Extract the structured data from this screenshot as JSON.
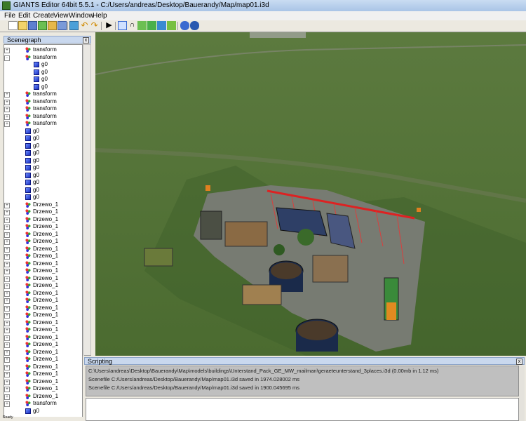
{
  "window": {
    "title": "GIANTS Editor 64bit 5.5.1 - C:/Users/andreas/Desktop/Bauerandy/Map/map01.i3d"
  },
  "menu": [
    "File",
    "Edit",
    "Create",
    "View",
    "Window",
    "Help"
  ],
  "toolbar_icons": [
    "new-icon",
    "open-icon",
    "save-icon",
    "reload-icon",
    "import-icon",
    "export-icon",
    "refresh-icon",
    "undo-icon",
    "redo-icon",
    "play-icon",
    "select-icon",
    "move-icon",
    "terrain-paint-icon",
    "foliage-icon",
    "texture-paint-icon",
    "placement-icon",
    "settings-icon",
    "info-icon"
  ],
  "scenegraph": {
    "title": "Scenegraph",
    "close": "x",
    "nodes": [
      {
        "label": "transform",
        "type": "transform",
        "depth": 1,
        "expander": "+"
      },
      {
        "label": "transform",
        "type": "transform",
        "depth": 1,
        "expander": "-"
      },
      {
        "label": "g0",
        "type": "shape",
        "depth": 2,
        "expander": ""
      },
      {
        "label": "g0",
        "type": "shape",
        "depth": 2,
        "expander": ""
      },
      {
        "label": "g0",
        "type": "shape",
        "depth": 2,
        "expander": ""
      },
      {
        "label": "g0",
        "type": "shape",
        "depth": 2,
        "expander": ""
      },
      {
        "label": "transform",
        "type": "transform",
        "depth": 1,
        "expander": "+"
      },
      {
        "label": "transform",
        "type": "transform",
        "depth": 1,
        "expander": "+"
      },
      {
        "label": "transform",
        "type": "transform",
        "depth": 1,
        "expander": "+"
      },
      {
        "label": "transform",
        "type": "transform",
        "depth": 1,
        "expander": "+"
      },
      {
        "label": "transform",
        "type": "transform",
        "depth": 1,
        "expander": "+"
      },
      {
        "label": "g0",
        "type": "shape",
        "depth": 1,
        "expander": ""
      },
      {
        "label": "g0",
        "type": "shape",
        "depth": 1,
        "expander": ""
      },
      {
        "label": "g0",
        "type": "shape",
        "depth": 1,
        "expander": ""
      },
      {
        "label": "g0",
        "type": "shape",
        "depth": 1,
        "expander": ""
      },
      {
        "label": "g0",
        "type": "shape",
        "depth": 1,
        "expander": ""
      },
      {
        "label": "g0",
        "type": "shape",
        "depth": 1,
        "expander": ""
      },
      {
        "label": "g0",
        "type": "shape",
        "depth": 1,
        "expander": ""
      },
      {
        "label": "g0",
        "type": "shape",
        "depth": 1,
        "expander": ""
      },
      {
        "label": "g0",
        "type": "shape",
        "depth": 1,
        "expander": ""
      },
      {
        "label": "g0",
        "type": "shape",
        "depth": 1,
        "expander": ""
      },
      {
        "label": "Drzewo_1",
        "type": "transform",
        "depth": 1,
        "expander": "+"
      },
      {
        "label": "Drzewo_1",
        "type": "transform",
        "depth": 1,
        "expander": "+"
      },
      {
        "label": "Drzewo_1",
        "type": "transform",
        "depth": 1,
        "expander": "+"
      },
      {
        "label": "Drzewo_1",
        "type": "transform",
        "depth": 1,
        "expander": "+"
      },
      {
        "label": "Drzewo_1",
        "type": "transform",
        "depth": 1,
        "expander": "+"
      },
      {
        "label": "Drzewo_1",
        "type": "transform",
        "depth": 1,
        "expander": "+"
      },
      {
        "label": "Drzewo_1",
        "type": "transform",
        "depth": 1,
        "expander": "+"
      },
      {
        "label": "Drzewo_1",
        "type": "transform",
        "depth": 1,
        "expander": "+"
      },
      {
        "label": "Drzewo_1",
        "type": "transform",
        "depth": 1,
        "expander": "+"
      },
      {
        "label": "Drzewo_1",
        "type": "transform",
        "depth": 1,
        "expander": "+"
      },
      {
        "label": "Drzewo_1",
        "type": "transform",
        "depth": 1,
        "expander": "+"
      },
      {
        "label": "Drzewo_1",
        "type": "transform",
        "depth": 1,
        "expander": "+"
      },
      {
        "label": "Drzewo_1",
        "type": "transform",
        "depth": 1,
        "expander": "+"
      },
      {
        "label": "Drzewo_1",
        "type": "transform",
        "depth": 1,
        "expander": "+"
      },
      {
        "label": "Drzewo_1",
        "type": "transform",
        "depth": 1,
        "expander": "+"
      },
      {
        "label": "Drzewo_1",
        "type": "transform",
        "depth": 1,
        "expander": "+"
      },
      {
        "label": "Drzewo_1",
        "type": "transform",
        "depth": 1,
        "expander": "+"
      },
      {
        "label": "Drzewo_1",
        "type": "transform",
        "depth": 1,
        "expander": "+"
      },
      {
        "label": "Drzewo_1",
        "type": "transform",
        "depth": 1,
        "expander": "+"
      },
      {
        "label": "Drzewo_1",
        "type": "transform",
        "depth": 1,
        "expander": "+"
      },
      {
        "label": "Drzewo_1",
        "type": "transform",
        "depth": 1,
        "expander": "+"
      },
      {
        "label": "Drzewo_1",
        "type": "transform",
        "depth": 1,
        "expander": "+"
      },
      {
        "label": "Drzewo_1",
        "type": "transform",
        "depth": 1,
        "expander": "+"
      },
      {
        "label": "Drzewo_1",
        "type": "transform",
        "depth": 1,
        "expander": "+"
      },
      {
        "label": "Drzewo_1",
        "type": "transform",
        "depth": 1,
        "expander": "+"
      },
      {
        "label": "Drzewo_1",
        "type": "transform",
        "depth": 1,
        "expander": "+"
      },
      {
        "label": "Drzewo_1",
        "type": "transform",
        "depth": 1,
        "expander": "+"
      },
      {
        "label": "transform",
        "type": "transform",
        "depth": 1,
        "expander": "+"
      },
      {
        "label": "g0",
        "type": "shape",
        "depth": 1,
        "expander": ""
      }
    ]
  },
  "scripting": {
    "title": "Scripting",
    "close": "x",
    "log": [
      "C:\\Users\\andreas\\Desktop\\Bauerandy\\Map\\models\\buildings\\Unterstand_Pack_GE_MW_mailman\\geraeteunterstand_3places.i3d (0.00mb in 1.12 ms)",
      "Scenefile C:/Users/andreas/Desktop/Bauerandy/Map/map01.i3d saved in 1974.028002 ms",
      "Scenefile C:/Users/andreas/Desktop/Bauerandy/Map/map01.i3d saved in 1900.045695 ms"
    ]
  },
  "status": {
    "text": "Ready"
  }
}
